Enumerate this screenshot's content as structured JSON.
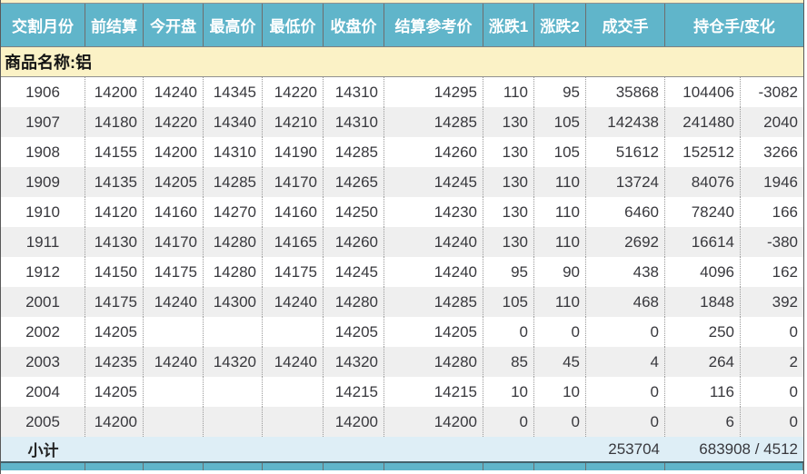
{
  "section": {
    "label": "商品名称:铝"
  },
  "table": {
    "headers": [
      "交割月份",
      "前结算",
      "今开盘",
      "最高价",
      "最低价",
      "收盘价",
      "结算参考价",
      "涨跌1",
      "涨跌2",
      "成交手",
      "持仓手/变化"
    ],
    "rows": [
      {
        "month": "1906",
        "prev_settle": "14200",
        "open": "14240",
        "high": "14345",
        "low": "14220",
        "close": "14310",
        "settle_ref": "14295",
        "chg1": "110",
        "chg2": "95",
        "volume": "35868",
        "open_interest": "104406",
        "oi_change": "-3082"
      },
      {
        "month": "1907",
        "prev_settle": "14180",
        "open": "14220",
        "high": "14340",
        "low": "14210",
        "close": "14310",
        "settle_ref": "14285",
        "chg1": "130",
        "chg2": "105",
        "volume": "142438",
        "open_interest": "241480",
        "oi_change": "2040"
      },
      {
        "month": "1908",
        "prev_settle": "14155",
        "open": "14200",
        "high": "14310",
        "low": "14190",
        "close": "14285",
        "settle_ref": "14260",
        "chg1": "130",
        "chg2": "105",
        "volume": "51612",
        "open_interest": "152512",
        "oi_change": "3266"
      },
      {
        "month": "1909",
        "prev_settle": "14135",
        "open": "14205",
        "high": "14285",
        "low": "14170",
        "close": "14265",
        "settle_ref": "14245",
        "chg1": "130",
        "chg2": "110",
        "volume": "13724",
        "open_interest": "84076",
        "oi_change": "1946"
      },
      {
        "month": "1910",
        "prev_settle": "14120",
        "open": "14160",
        "high": "14270",
        "low": "14160",
        "close": "14250",
        "settle_ref": "14230",
        "chg1": "130",
        "chg2": "110",
        "volume": "6460",
        "open_interest": "78240",
        "oi_change": "166"
      },
      {
        "month": "1911",
        "prev_settle": "14130",
        "open": "14170",
        "high": "14280",
        "low": "14165",
        "close": "14260",
        "settle_ref": "14240",
        "chg1": "130",
        "chg2": "110",
        "volume": "2692",
        "open_interest": "16614",
        "oi_change": "-380"
      },
      {
        "month": "1912",
        "prev_settle": "14150",
        "open": "14175",
        "high": "14280",
        "low": "14175",
        "close": "14245",
        "settle_ref": "14240",
        "chg1": "95",
        "chg2": "90",
        "volume": "438",
        "open_interest": "4096",
        "oi_change": "162"
      },
      {
        "month": "2001",
        "prev_settle": "14175",
        "open": "14240",
        "high": "14300",
        "low": "14240",
        "close": "14280",
        "settle_ref": "14285",
        "chg1": "105",
        "chg2": "110",
        "volume": "468",
        "open_interest": "1848",
        "oi_change": "392"
      },
      {
        "month": "2002",
        "prev_settle": "14205",
        "open": "",
        "high": "",
        "low": "",
        "close": "14205",
        "settle_ref": "14205",
        "chg1": "0",
        "chg2": "0",
        "volume": "0",
        "open_interest": "250",
        "oi_change": "0"
      },
      {
        "month": "2003",
        "prev_settle": "14235",
        "open": "14240",
        "high": "14320",
        "low": "14240",
        "close": "14320",
        "settle_ref": "14280",
        "chg1": "85",
        "chg2": "45",
        "volume": "4",
        "open_interest": "264",
        "oi_change": "2"
      },
      {
        "month": "2004",
        "prev_settle": "14205",
        "open": "",
        "high": "",
        "low": "",
        "close": "14215",
        "settle_ref": "14215",
        "chg1": "10",
        "chg2": "10",
        "volume": "0",
        "open_interest": "116",
        "oi_change": "0"
      },
      {
        "month": "2005",
        "prev_settle": "14200",
        "open": "",
        "high": "",
        "low": "",
        "close": "14200",
        "settle_ref": "14200",
        "chg1": "0",
        "chg2": "0",
        "volume": "0",
        "open_interest": "6",
        "oi_change": "0"
      }
    ],
    "subtotal": {
      "label": "小计",
      "volume": "253704",
      "open_interest_change": "683908 / 4512"
    }
  },
  "colors": {
    "header_bg": "#60B5CA",
    "header_text": "#FFFFFF",
    "section_bg": "#FBF2C6",
    "row_alt_bg": "#EFEFEF",
    "subtotal_bg": "#DEEEF6",
    "text": "#38383D",
    "grid_dotted": "#999999",
    "header_separator": "#6E6E6E",
    "outer_border": "#595959"
  }
}
